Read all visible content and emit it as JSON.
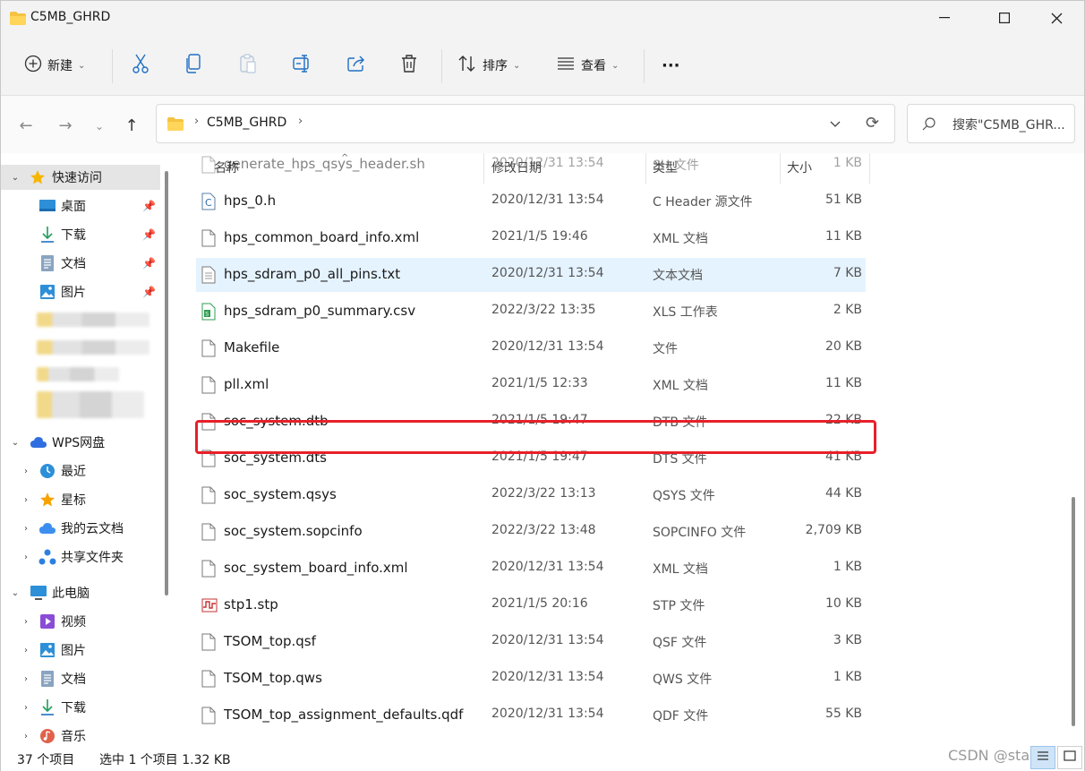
{
  "window": {
    "title": "C5MB_GHRD"
  },
  "toolbar": {
    "new_label": "新建",
    "sort_label": "排序",
    "view_label": "查看",
    "more_label": "···"
  },
  "address": {
    "crumb": "C5MB_GHRD",
    "search_placeholder": "搜索\"C5MB_GHR..."
  },
  "sidebar": {
    "quick_access": "快速访问",
    "desktop": "桌面",
    "downloads": "下载",
    "documents": "文档",
    "pictures": "图片",
    "wps": "WPS网盘",
    "recent": "最近",
    "starred": "星标",
    "my_cloud": "我的云文档",
    "shared": "共享文件夹",
    "this_pc": "此电脑",
    "videos": "视频",
    "pc_pictures": "图片",
    "pc_documents": "文档",
    "pc_downloads": "下载",
    "music": "音乐"
  },
  "columns": {
    "name": "名称",
    "date": "修改日期",
    "type": "类型",
    "size": "大小"
  },
  "files": [
    {
      "name": "generate_hps_qsys_header.sh",
      "date": "2020/12/31 13:54",
      "type": "SH 文件",
      "size": "1 KB",
      "icon": "file-icon"
    },
    {
      "name": "hps_0.h",
      "date": "2020/12/31 13:54",
      "type": "C Header 源文件",
      "size": "51 KB",
      "icon": "c-header-icon"
    },
    {
      "name": "hps_common_board_info.xml",
      "date": "2021/1/5 19:46",
      "type": "XML 文档",
      "size": "11 KB",
      "icon": "file-icon"
    },
    {
      "name": "hps_sdram_p0_all_pins.txt",
      "date": "2020/12/31 13:54",
      "type": "文本文档",
      "size": "7 KB",
      "icon": "text-file-icon"
    },
    {
      "name": "hps_sdram_p0_summary.csv",
      "date": "2022/3/22 13:35",
      "type": "XLS 工作表",
      "size": "2 KB",
      "icon": "spreadsheet-icon"
    },
    {
      "name": "Makefile",
      "date": "2020/12/31 13:54",
      "type": "文件",
      "size": "20 KB",
      "icon": "file-icon"
    },
    {
      "name": "pll.xml",
      "date": "2021/1/5 12:33",
      "type": "XML 文档",
      "size": "11 KB",
      "icon": "file-icon"
    },
    {
      "name": "soc_system.dtb",
      "date": "2021/1/5 19:47",
      "type": "DTB 文件",
      "size": "22 KB",
      "icon": "file-icon"
    },
    {
      "name": "soc_system.dts",
      "date": "2021/1/5 19:47",
      "type": "DTS 文件",
      "size": "41 KB",
      "icon": "file-icon"
    },
    {
      "name": "soc_system.qsys",
      "date": "2022/3/22 13:13",
      "type": "QSYS 文件",
      "size": "44 KB",
      "icon": "file-icon"
    },
    {
      "name": "soc_system.sopcinfo",
      "date": "2022/3/22 13:48",
      "type": "SOPCINFO 文件",
      "size": "2,709 KB",
      "icon": "file-icon"
    },
    {
      "name": "soc_system_board_info.xml",
      "date": "2020/12/31 13:54",
      "type": "XML 文档",
      "size": "1 KB",
      "icon": "file-icon"
    },
    {
      "name": "stp1.stp",
      "date": "2021/1/5 20:16",
      "type": "STP 文件",
      "size": "10 KB",
      "icon": "stp-icon"
    },
    {
      "name": "TSOM_top.qsf",
      "date": "2020/12/31 13:54",
      "type": "QSF 文件",
      "size": "3 KB",
      "icon": "file-icon"
    },
    {
      "name": "TSOM_top.qws",
      "date": "2020/12/31 13:54",
      "type": "QWS 文件",
      "size": "1 KB",
      "icon": "file-icon"
    },
    {
      "name": "TSOM_top_assignment_defaults.qdf",
      "date": "2020/12/31 13:54",
      "type": "QDF 文件",
      "size": "55 KB",
      "icon": "file-icon"
    }
  ],
  "status": {
    "item_count": "37 个项目",
    "selection": "选中 1 个项目  1.32 KB"
  },
  "watermark": "CSDN @sta",
  "colors": {
    "highlight_border": "#e8202a",
    "hover_row": "#e5f3ff",
    "chrome_bg": "#f3f3f3"
  }
}
